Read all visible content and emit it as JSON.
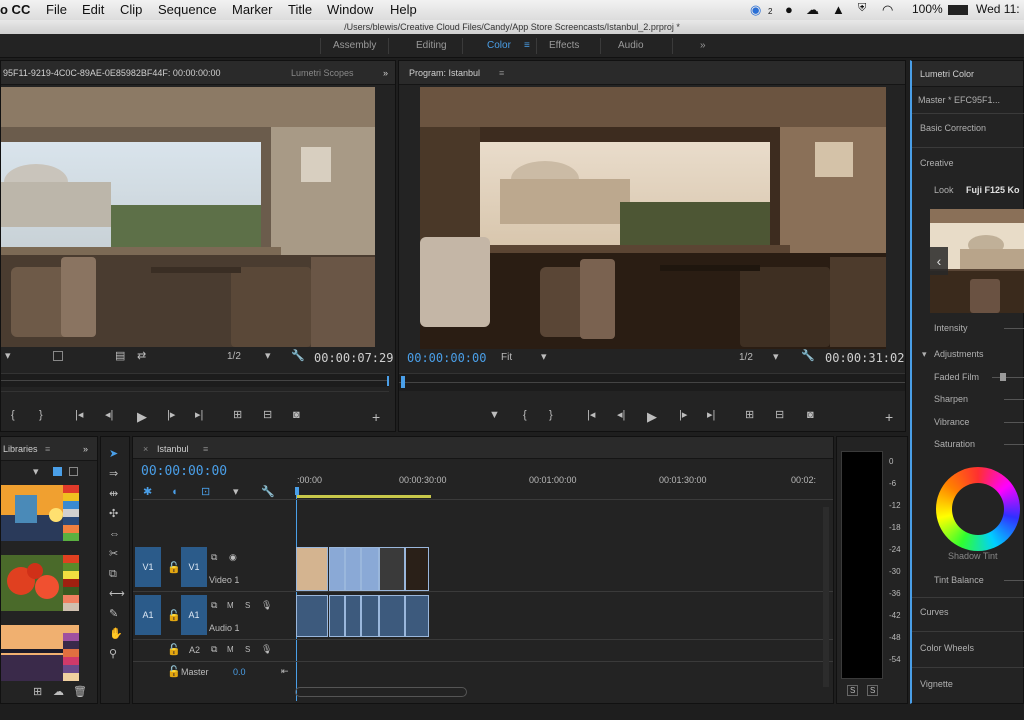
{
  "menubar": {
    "app": "o CC",
    "items": [
      "File",
      "Edit",
      "Clip",
      "Sequence",
      "Marker",
      "Title",
      "Window",
      "Help"
    ],
    "status": {
      "battery": "100%",
      "clock": "Wed 11:",
      "cc_badge": "2"
    }
  },
  "titlebar": {
    "path": "/Users/blewis/Creative Cloud Files/Candy/App Store Screencasts/Istanbul_2.prproj *"
  },
  "workspaces": {
    "items": [
      "Assembly",
      "Editing",
      "Color",
      "Effects",
      "Audio"
    ],
    "active": "Color",
    "more": "»"
  },
  "source_monitor": {
    "tab": "95F11-9219-4C0C-89AE-0E85982BF44F: 00:00:00:00",
    "tab2": "Lumetri Scopes",
    "more": "»",
    "resolution": "1/2",
    "timecode": "00:00:07:29"
  },
  "program_monitor": {
    "tab": "Program: Istanbul",
    "timecode_current": "00:00:00:00",
    "fit": "Fit",
    "resolution": "1/2",
    "timecode_duration": "00:00:31:02"
  },
  "libraries": {
    "tab": "Libraries",
    "more": "»"
  },
  "timeline": {
    "tab": "Istanbul",
    "timecode": "00:00:00:00",
    "ruler": [
      ":00:00",
      "00:00:30:00",
      "00:01:00:00",
      "00:01:30:00",
      "00:02:"
    ],
    "tracks": {
      "v1_src": "V1",
      "v1": "V1",
      "v1_name": "Video 1",
      "a1_src": "A1",
      "a1": "A1",
      "a1_name": "Audio 1",
      "a2": "A2",
      "master": "Master",
      "master_value": "0.0",
      "mute": "M",
      "solo": "S"
    }
  },
  "audio_meter": {
    "scale": [
      "0",
      "-6",
      "-12",
      "-18",
      "-24",
      "-30",
      "-36",
      "-42",
      "-48",
      "-54"
    ],
    "solo_left": "S",
    "solo_right": "S"
  },
  "lumetri": {
    "tab": "Lumetri Color",
    "master": "Master * EFC95F1...",
    "basic_correction": "Basic Correction",
    "creative": "Creative",
    "look_label": "Look",
    "look_value": "Fuji F125 Ko",
    "intensity": "Intensity",
    "adjustments": "Adjustments",
    "faded_film": "Faded Film",
    "sharpen": "Sharpen",
    "vibrance": "Vibrance",
    "saturation": "Saturation",
    "shadow_tint": "Shadow Tint",
    "tint_balance": "Tint Balance",
    "curves": "Curves",
    "color_wheels": "Color Wheels",
    "vignette": "Vignette"
  },
  "icons": {
    "play": "play-icon",
    "step_back": "step-back-icon",
    "step_fwd": "step-forward-icon",
    "mark_in": "mark-in-icon",
    "mark_out": "mark-out-icon",
    "export_frame": "camera-icon",
    "add": "plus-icon",
    "wrench": "wrench-icon"
  },
  "colors": {
    "accent": "#4a9fe8",
    "track_blue": "#2b5b8a",
    "clip_video": "#8aa9d6",
    "clip_audio": "#3d5a7d",
    "work_area": "#c8c84a"
  }
}
